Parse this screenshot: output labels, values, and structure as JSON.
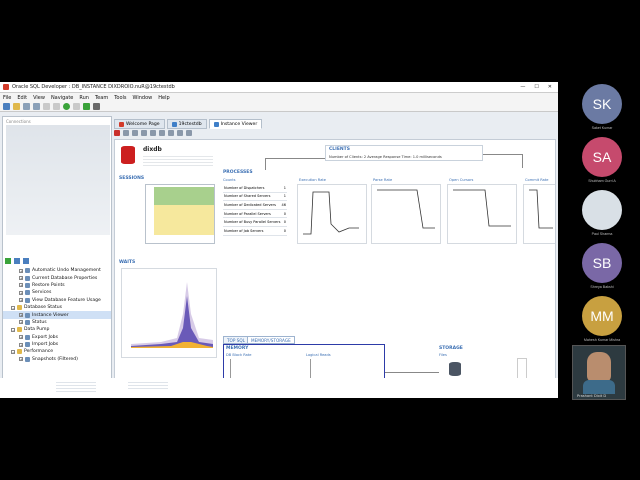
{
  "window": {
    "title": "Oracle SQL Developer : DB_INSTANCE DIXDROIO.nuR@19ctestdb"
  },
  "menu": [
    "File",
    "Edit",
    "View",
    "Navigate",
    "Run",
    "Team",
    "Tools",
    "Window",
    "Help"
  ],
  "left_panel": {
    "header": "Connections",
    "tree": [
      {
        "label": "Automatic Undo Management",
        "indent": 2
      },
      {
        "label": "Current Database Properties",
        "indent": 2
      },
      {
        "label": "Restore Points",
        "indent": 2
      },
      {
        "label": "Services",
        "indent": 2
      },
      {
        "label": "View Database Feature Usage",
        "indent": 2
      },
      {
        "label": "Database Status",
        "indent": 1
      },
      {
        "label": "Instance Viewer",
        "indent": 2,
        "selected": true
      },
      {
        "label": "Status",
        "indent": 2
      },
      {
        "label": "Data Pump",
        "indent": 1
      },
      {
        "label": "Export Jobs",
        "indent": 2
      },
      {
        "label": "Import Jobs",
        "indent": 2
      },
      {
        "label": "Performance",
        "indent": 1
      },
      {
        "label": "Snapshots (Filtered)",
        "indent": 2
      }
    ]
  },
  "tabs": [
    {
      "label": "Welcome Page",
      "color": "#d23b2a"
    },
    {
      "label": "19ctestdb",
      "color": "#3f7fc8"
    },
    {
      "label": "Instance Viewer",
      "color": "#3f7fc8",
      "active": true
    }
  ],
  "viewer": {
    "db_name": "dixdb",
    "clients_title": "CLIENTS",
    "clients_text": "Number of Clients: 2    Average Response Time: 1.0 milliseconds",
    "sessions_title": "SESSIONS",
    "processes_title": "PROCESSES",
    "proc_cols": [
      "Counts",
      "Execution Rate",
      "Parse Rate",
      "Open Cursors",
      "Commit Rate"
    ],
    "proc_rows": [
      {
        "label": "Number of Dispatchers",
        "value": "1"
      },
      {
        "label": "Number of Shared Servers",
        "value": "1"
      },
      {
        "label": "Number of Dedicated Servers",
        "value": "46"
      },
      {
        "label": "Number of Parallel Servers",
        "value": "0"
      },
      {
        "label": "Number of Busy Parallel Servers",
        "value": "0"
      },
      {
        "label": "Number of Job Servers",
        "value": "0"
      }
    ],
    "waits_title": "WAITS",
    "subtabs": [
      "TOP SQL",
      "MEMORY/STORAGE"
    ],
    "memory_title": "MEMORY",
    "db_block_rate": "DB Block Rate",
    "logical_reads": "Logical Reads",
    "allocation": "Allocation",
    "redo_generated": "Redo Generated",
    "storage_title": "STORAGE",
    "files": "Files",
    "redo_log": "Redo Log"
  },
  "participants": [
    {
      "initials": "SK",
      "name": "Saket Kumar",
      "color": "#6b7aa3"
    },
    {
      "initials": "SA",
      "name": "Shubham Gurri A",
      "color": "#c64a6d"
    },
    {
      "initials": "",
      "name": "Paul Sharma",
      "color": "#d9e0e6"
    },
    {
      "initials": "SB",
      "name": "Shreya Bakshi",
      "color": "#7a68a6"
    },
    {
      "initials": "MM",
      "name": "Mahesh Kumar Mishra",
      "color": "#c8a040"
    }
  ],
  "active_speaker": {
    "name": "Prashant Dixit D"
  }
}
